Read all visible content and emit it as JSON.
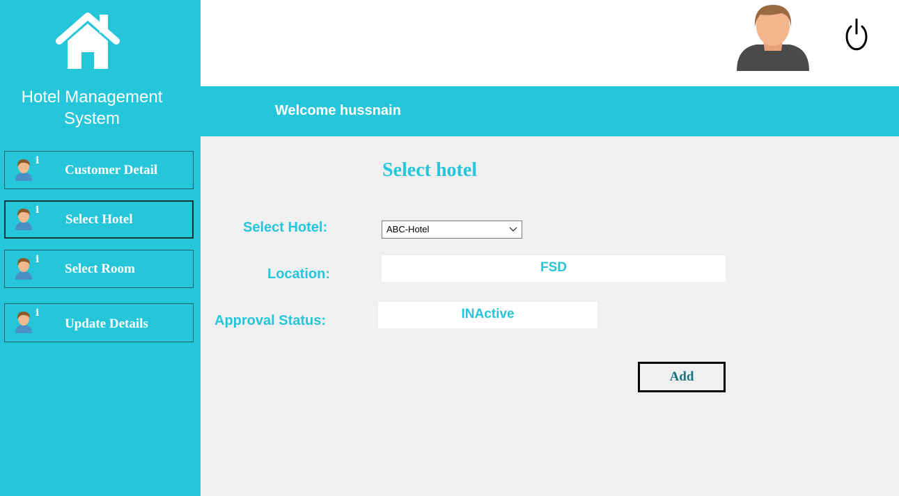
{
  "app": {
    "title": "Hotel Management System"
  },
  "sidebar": {
    "items": [
      {
        "label": "Customer Detail",
        "info": "i",
        "active": false
      },
      {
        "label": "Select Hotel",
        "info": "i",
        "active": true
      },
      {
        "label": "Select Room",
        "info": "i",
        "active": false
      },
      {
        "label": "Update Details",
        "info": "i",
        "active": false
      }
    ]
  },
  "header": {
    "welcome": "Welcome hussnain"
  },
  "form": {
    "heading": "Select hotel",
    "hotel_label": "Select Hotel:",
    "hotel_value": "ABC-Hotel",
    "location_label": "Location:",
    "location_value": "FSD",
    "status_label": "Approval Status:",
    "status_value": "INActive",
    "add_label": "Add"
  },
  "icons": {
    "home": "home-icon",
    "user": "user-avatar-icon",
    "power": "power-icon",
    "nav": "user-info-icon",
    "dropdown": "chevron-down-icon"
  },
  "colors": {
    "accent": "#26c6da",
    "background": "#f0f0f0",
    "topbar": "#ffffff"
  }
}
